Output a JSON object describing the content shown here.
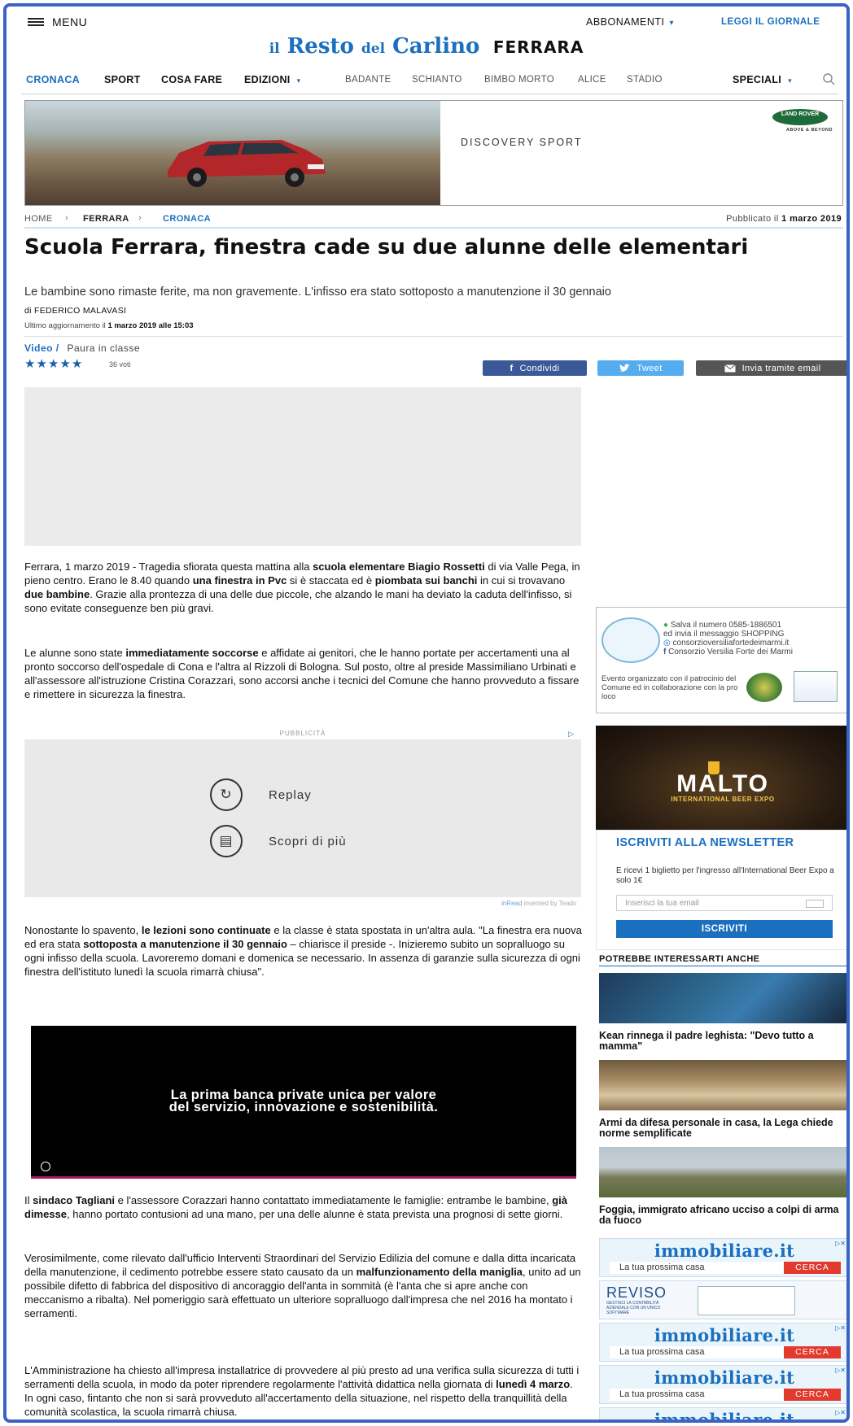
{
  "topbar": {
    "menu_label": "MENU",
    "abbonamenti": "ABBONAMENTI",
    "leggi": "LEGGI IL GIORNALE"
  },
  "logo": {
    "brand_il": "il",
    "brand_resto": "Resto",
    "brand_del": "del",
    "brand_carlino": "Carlino",
    "city": "FERRARA"
  },
  "nav": {
    "items": [
      "CRONACA",
      "SPORT",
      "COSA FARE",
      "EDIZIONI"
    ],
    "tags": [
      "BADANTE",
      "SCHIANTO",
      "BIMBO MORTO",
      "ALICE",
      "STADIO"
    ],
    "speciali": "SPECIALI"
  },
  "banner": {
    "text": "DISCOVERY SPORT",
    "logo_text": "LAND ROVER",
    "logo_sub": "ABOVE & BEYOND"
  },
  "breadcrumb": {
    "home": "HOME",
    "city": "FERRARA",
    "section": "CRONACA",
    "published_label": "Pubblicato il",
    "published_date": "1 marzo 2019"
  },
  "article": {
    "title": "Scuola Ferrara, finestra cade su due alunne delle elementari",
    "subtitle": "Le bambine sono rimaste ferite, ma non gravemente. L'infisso era stato sottoposto a manutenzione il 30 gennaio",
    "author": "di FEDERICO MALAVASI",
    "updated_label": "Ultimo aggiornamento il",
    "updated_date": "1 marzo 2019 alle 15:03",
    "video_label": "Video /",
    "video_title": "Paura in classe",
    "votes": "36 voti"
  },
  "share": {
    "facebook": "Condividi",
    "twitter": "Tweet",
    "email": "Invia tramite email"
  },
  "ads": {
    "pubblicita": "PUBBLICITÀ",
    "replay": "Replay",
    "scopri": "Scopri di più",
    "teads_brand": "inRead",
    "teads_tail": "invented by Teads",
    "video_line1": "La prima banca private unica per valore",
    "video_line2": "del servizio, innovazione e sostenibilità."
  },
  "sidebar": {
    "event_lines": [
      "Salva il numero 0585-1886501",
      "ed invia il messaggio SHOPPING",
      "consorzioversiliafortedeimarmi.it",
      "Consorzio Versilia Forte dei Marmi"
    ],
    "event_note": "Evento organizzato con il patrocinio del Comune ed in collaborazione con la pro loco",
    "malto_title": "MALTO",
    "malto_sub": "INTERNATIONAL BEER EXPO",
    "newsletter_title": "ISCRIVITI ALLA NEWSLETTER",
    "newsletter_text": "E ricevi 1 biglietto per l'ingresso all'International Beer Expo a solo 1€",
    "newsletter_placeholder": "Inserisci la tua email",
    "newsletter_button": "ISCRIVITI",
    "related_heading": "POTREBBE INTERESSARTI ANCHE",
    "related": [
      "Kean rinnega il padre leghista: \"Devo tutto a mamma\"",
      "Armi da difesa personale in casa, la Lega chiede norme semplificate",
      "Foggia, immigrato africano ucciso a colpi di arma da fuoco"
    ],
    "immobiliare_logo": "immobiliare.it",
    "immobiliare_text": "La tua prossima casa",
    "immobiliare_cta": "CERCA",
    "reviso_name": "REVISO",
    "reviso_tag": "GESTISCI LA CONTABILITÀ AZIENDALE CON UN UNICO SOFTWARE"
  }
}
